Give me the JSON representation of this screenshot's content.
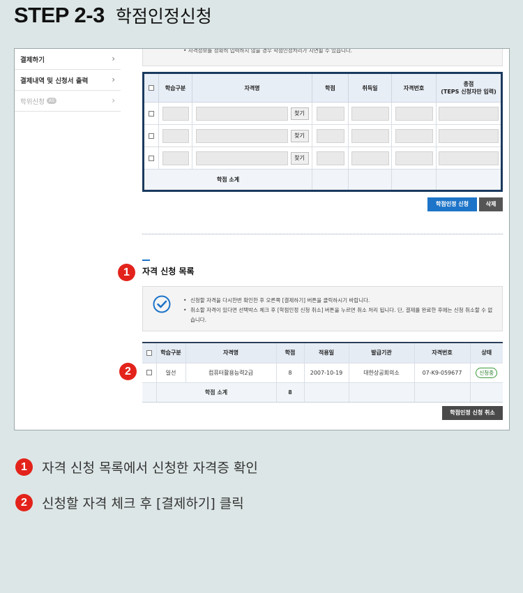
{
  "header": {
    "step": "STEP 2-3",
    "subtitle": "학점인정신청"
  },
  "sidebar": {
    "items": [
      {
        "label": "결제하기"
      },
      {
        "label": "결제내역 및 신청서 출력"
      },
      {
        "label": "학위신청",
        "badge": "AS"
      }
    ]
  },
  "top_note": "자격정보를 정확히 입력하지 않을 경우 학점인정처리가 지연될 수 있습니다.",
  "input_table": {
    "headers": [
      "학습구분",
      "자격명",
      "학점",
      "취득일",
      "자격번호",
      "총점",
      "(TEPS 신청자만 입력)"
    ],
    "find_label": "찾기",
    "subtotal_label": "학점 소계"
  },
  "buttons": {
    "apply": "학점인정 신청",
    "delete": "삭제",
    "cancel": "학점인정 신청 취소"
  },
  "section": {
    "title": "자격 신청 목록"
  },
  "info_notes": [
    "신청할 자격을 다시한번 확인한 후 오른쪽 [결제하기] 버튼을 클릭하시기 바랍니다.",
    "취소할 자격이 있다면 선택박스 체크 후 [학점인정 신청 취소] 버튼을 누르면 취소 처리 됩니다. 단, 결제를 완료한 후에는 신청 취소할 수 없습니다."
  ],
  "list_table": {
    "headers": [
      "학습구분",
      "자격명",
      "학점",
      "적용일",
      "발급기관",
      "자격번호",
      "상태"
    ],
    "row": {
      "type": "일선",
      "name": "컴퓨터활용능력2급",
      "credit": "8",
      "date": "2007-10-19",
      "issuer": "대한상공회의소",
      "number": "07-K9-059677",
      "status": "신청중"
    },
    "subtotal_label": "학점 소계",
    "subtotal_value": "8"
  },
  "markers": [
    "1",
    "2"
  ],
  "steps": [
    {
      "num": "1",
      "text": "자격 신청 목록에서 신청한 자격증 확인"
    },
    {
      "num": "2",
      "text": "신청할 자격 체크 후 [결제하기] 클릭"
    }
  ],
  "colors": {
    "accent_blue": "#1d74c8",
    "marker_red": "#e3231b",
    "table_border": "#1a3a5e"
  }
}
